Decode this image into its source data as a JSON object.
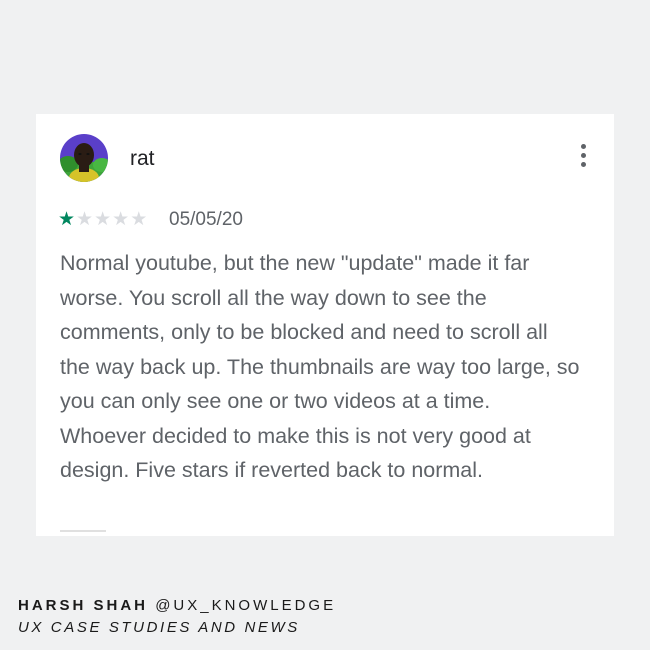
{
  "review": {
    "username": "rat",
    "rating": 1,
    "rating_max": 5,
    "date": "05/05/20",
    "text": "Normal youtube, but the new \"update\" made it far worse. You scroll all the way down to see the comments, only to be blocked and need to scroll all the way back up. The thumbnails are way too large, so you can only see one or two videos at a time. Whoever decided to make this is not very good at design. Five stars if reverted back to normal.",
    "more_icon": "more-vert-icon",
    "colors": {
      "star_filled": "#01875f",
      "star_empty": "#dadce0"
    }
  },
  "footer": {
    "author": "HARSH SHAH",
    "handle": "@UX_KNOWLEDGE",
    "tagline": "UX CASE STUDIES AND NEWS"
  }
}
